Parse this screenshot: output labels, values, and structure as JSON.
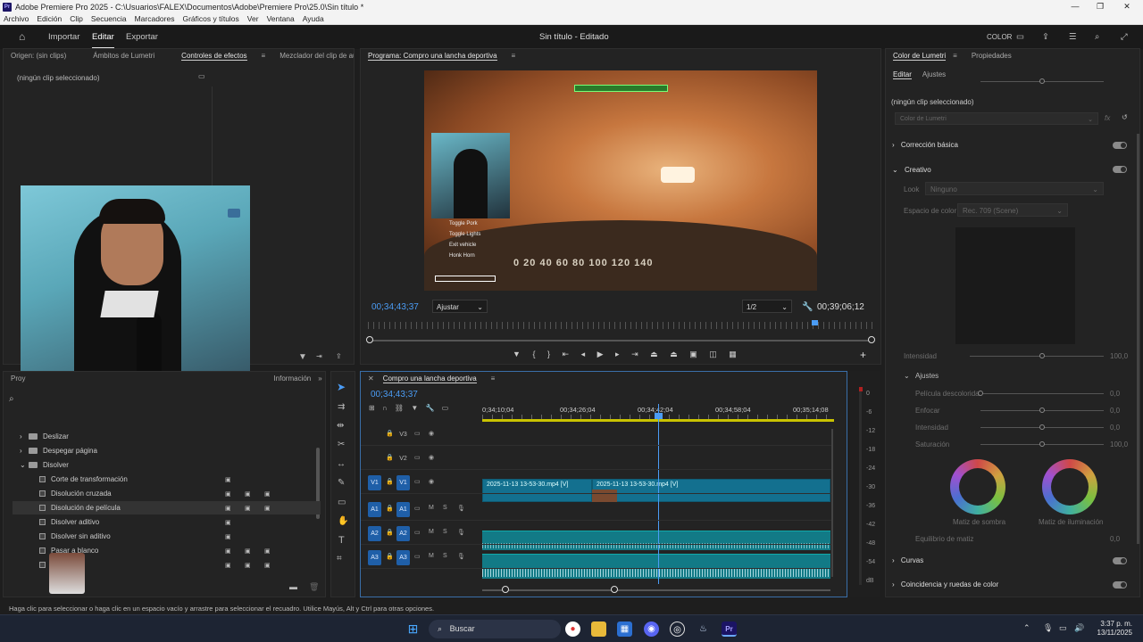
{
  "window": {
    "title": "Adobe Premiere Pro 2025 - C:\\Usuarios\\FALEX\\Documentos\\Adobe\\Premiere Pro\\25.0\\Sin título *",
    "logo": "Pr"
  },
  "menu": [
    "Archivo",
    "Edición",
    "Clip",
    "Secuencia",
    "Marcadores",
    "Gráficos y títulos",
    "Ver",
    "Ventana",
    "Ayuda"
  ],
  "appbar": {
    "tabs": [
      "Importar",
      "Editar",
      "Exportar"
    ],
    "active_tab": "Editar",
    "project_title": "Sin título - Editado",
    "color_label": "COLOR"
  },
  "source_panel": {
    "tabs": [
      "Origen: (sin clips)",
      "Ámbitos de Lumetri",
      "Controles de efectos",
      "Mezclador del clip de audio: Con"
    ],
    "active": "Controles de efectos",
    "empty_text": "(ningún clip seleccionado)"
  },
  "program_panel": {
    "title": "Programa: Compro una lancha deportiva",
    "timecode_current": "00;34;43;37",
    "fit": "Ajustar",
    "resolution": "1/2",
    "timecode_total": "00;39;06;12",
    "game_menu": [
      "Toggle Pork",
      "Toggle Lights",
      "Exit vehicle",
      "Honk Horn"
    ],
    "speedometer": "0 20 40 60 80 100 120 140"
  },
  "project_panel": {
    "tab_partial": "Proy",
    "info_tab": "Información",
    "items": [
      {
        "label": "Deslizar",
        "type": "folder",
        "indent": 1,
        "icons": 0
      },
      {
        "label": "Despegar página",
        "type": "folder",
        "indent": 1,
        "icons": 0
      },
      {
        "label": "Disolver",
        "type": "folder-open",
        "indent": 1,
        "icons": 0
      },
      {
        "label": "Corte de transformación",
        "type": "effect",
        "indent": 2,
        "icons": 1
      },
      {
        "label": "Disolución cruzada",
        "type": "effect",
        "indent": 2,
        "icons": 3
      },
      {
        "label": "Disolución de película",
        "type": "effect",
        "indent": 2,
        "icons": 3,
        "selected": true
      },
      {
        "label": "Disolver aditivo",
        "type": "effect",
        "indent": 2,
        "icons": 1
      },
      {
        "label": "Disolver sin aditivo",
        "type": "effect",
        "indent": 2,
        "icons": 1
      },
      {
        "label": "Pasar a blanco",
        "type": "effect",
        "indent": 2,
        "icons": 3
      },
      {
        "label": "P",
        "type": "effect",
        "indent": 2,
        "icons": 3
      }
    ]
  },
  "timeline": {
    "sequence_name": "Compro una lancha deportiva",
    "timecode": "00;34;43;37",
    "ruler": [
      "0;34;10;04",
      "00;34;26;04",
      "00;34;42;04",
      "00;34;58;04",
      "00;35;14;08"
    ],
    "tracks": [
      {
        "id": "V3",
        "src": ""
      },
      {
        "id": "V2",
        "src": ""
      },
      {
        "id": "V1",
        "src": "V1"
      },
      {
        "id": "A1",
        "src": "A1"
      },
      {
        "id": "A2",
        "src": "A2"
      },
      {
        "id": "A3",
        "src": "A3"
      }
    ],
    "video_clips": [
      "2025-11-13 13-53-30.mp4 [V]",
      "2025-11-13 13-53-30.mp4 [V]"
    ],
    "meter_scale": [
      "0",
      "-6",
      "-12",
      "-18",
      "-24",
      "-30",
      "-36",
      "-42",
      "-48",
      "-54",
      "dB"
    ]
  },
  "lumetri": {
    "tabs": [
      "Color de Lumetri",
      "Propiedades"
    ],
    "subtabs": [
      "Editar",
      "Ajustes"
    ],
    "no_clip": "(ningún clip seleccionado)",
    "color_select": "Color de Lumetri",
    "sections": {
      "basic": "Corrección básica",
      "creative": "Creativo",
      "curves": "Curvas",
      "match": "Coincidencia y ruedas de color"
    },
    "look_label": "Look",
    "look_value": "Ninguno",
    "colorspace_label": "Espacio de color",
    "colorspace_value": "Rec. 709 (Scene)",
    "intensity_label": "Intensidad",
    "intensity_value": "100,0",
    "adjust_label": "Ajustes",
    "sliders": [
      {
        "label": "Película descolorida",
        "value": "0,0",
        "pos": 0.0
      },
      {
        "label": "Enfocar",
        "value": "0,0",
        "pos": 0.5
      },
      {
        "label": "Intensidad",
        "value": "0,0",
        "pos": 0.5
      },
      {
        "label": "Saturación",
        "value": "100,0",
        "pos": 0.5
      }
    ],
    "wheel_labels": [
      "Matiz de sombra",
      "Matiz de iluminación"
    ],
    "balance_label": "Equilibrio de matiz",
    "balance_value": "0,0"
  },
  "status_bar": "Haga clic para seleccionar o haga clic en un espacio vacío y arrastre para seleccionar el recuadro. Utilice Mayús, Alt y Ctrl para otras opciones.",
  "taskbar": {
    "search": "Buscar",
    "time": "3:37 p. m.",
    "date": "13/11/2025"
  },
  "colors": {
    "accent": "#4b9cf5",
    "clip": "#13708f",
    "playhead": "#4b9cf5"
  }
}
